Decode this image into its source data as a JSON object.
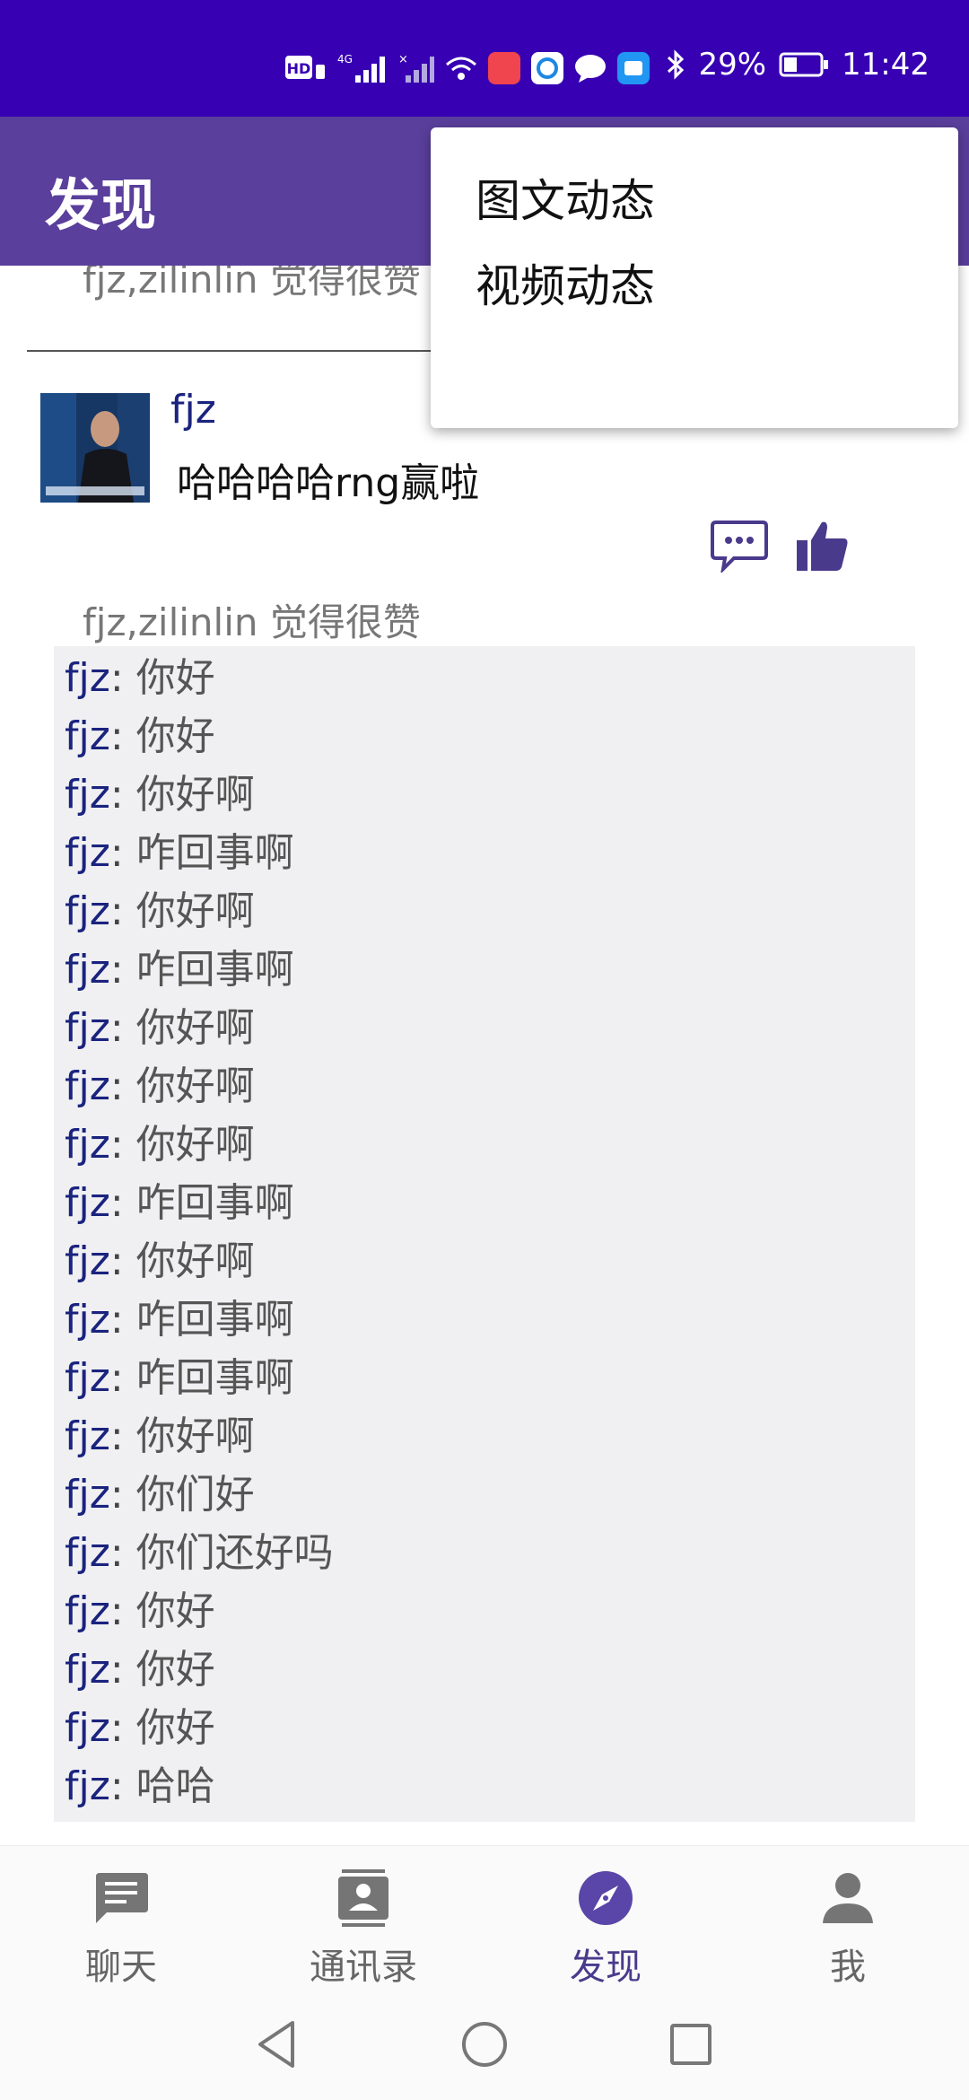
{
  "status_bar": {
    "battery": "29%",
    "time": "11:42",
    "icons": [
      "hd-icon",
      "signal-4g-icon",
      "signal-icon",
      "wifi-icon",
      "huawei-app-icon",
      "chat-app-icon",
      "message-icon",
      "app-icon",
      "bluetooth-icon",
      "battery-icon"
    ],
    "color": "#3700b3"
  },
  "app_bar": {
    "title": "发现",
    "color": "#5a3f9c"
  },
  "popup_menu": {
    "items": [
      "图文动态",
      "视频动态"
    ]
  },
  "feed": {
    "previous_likes": "fjz,zilinlin 觉得很赞",
    "post": {
      "username": "fjz",
      "text": "哈哈哈哈rng赢啦",
      "likes_text": "fjz,zilinlin 觉得很赞",
      "comments": [
        {
          "user": "fjz",
          "sep": ": ",
          "text": "你好"
        },
        {
          "user": "fjz",
          "sep": ": ",
          "text": "你好"
        },
        {
          "user": "fjz",
          "sep": ": ",
          "text": "你好啊"
        },
        {
          "user": "fjz",
          "sep": ": ",
          "text": "咋回事啊"
        },
        {
          "user": "fjz",
          "sep": ": ",
          "text": "你好啊"
        },
        {
          "user": "fjz",
          "sep": ": ",
          "text": "咋回事啊"
        },
        {
          "user": "fjz",
          "sep": ": ",
          "text": "你好啊"
        },
        {
          "user": "fjz",
          "sep": ": ",
          "text": "你好啊"
        },
        {
          "user": "fjz",
          "sep": ": ",
          "text": "你好啊"
        },
        {
          "user": "fjz",
          "sep": ": ",
          "text": "咋回事啊"
        },
        {
          "user": "fjz",
          "sep": ": ",
          "text": "你好啊"
        },
        {
          "user": "fjz",
          "sep": ": ",
          "text": "咋回事啊"
        },
        {
          "user": "fjz",
          "sep": ": ",
          "text": "咋回事啊"
        },
        {
          "user": "fjz",
          "sep": ": ",
          "text": "你好啊"
        },
        {
          "user": "fjz",
          "sep": ": ",
          "text": "你们好"
        },
        {
          "user": "fjz",
          "sep": ": ",
          "text": "你们还好吗"
        },
        {
          "user": "fjz",
          "sep": ": ",
          "text": "你好"
        },
        {
          "user": "fjz",
          "sep": ": ",
          "text": "你好"
        },
        {
          "user": "fjz",
          "sep": ": ",
          "text": "你好"
        },
        {
          "user": "fjz",
          "sep": ": ",
          "text": "哈哈"
        }
      ]
    }
  },
  "bottom_nav": {
    "items": [
      {
        "label": "聊天",
        "icon": "chat-icon"
      },
      {
        "label": "通讯录",
        "icon": "contacts-icon"
      },
      {
        "label": "发现",
        "icon": "compass-icon",
        "active": true
      },
      {
        "label": "我",
        "icon": "person-icon"
      }
    ],
    "active_color": "#4a3a8c",
    "inactive_color": "#757575"
  },
  "system_nav": {
    "buttons": [
      "back-icon",
      "home-icon",
      "recents-icon"
    ]
  }
}
